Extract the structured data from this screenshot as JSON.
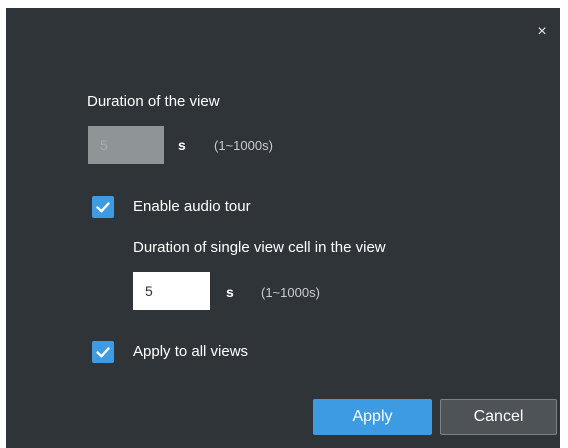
{
  "dialog": {
    "close_symbol": "×",
    "view_duration": {
      "label": "Duration of the view",
      "value": "5",
      "unit": "s",
      "range": "(1~1000s)",
      "disabled": true
    },
    "audio_tour": {
      "label": "Enable audio tour",
      "checked": true
    },
    "cell_duration": {
      "label": "Duration of single view cell in the view",
      "value": "5",
      "unit": "s",
      "range": "(1~1000s)"
    },
    "apply_all": {
      "label": "Apply to all views",
      "checked": true
    },
    "buttons": {
      "apply": "Apply",
      "cancel": "Cancel"
    },
    "colors": {
      "background": "#2f3438",
      "accent": "#3d9be3",
      "disabled_input": "#8f9497",
      "cancel_button": "#4e5357"
    },
    "icons": {
      "close": "close-icon",
      "check": "check-icon"
    }
  }
}
